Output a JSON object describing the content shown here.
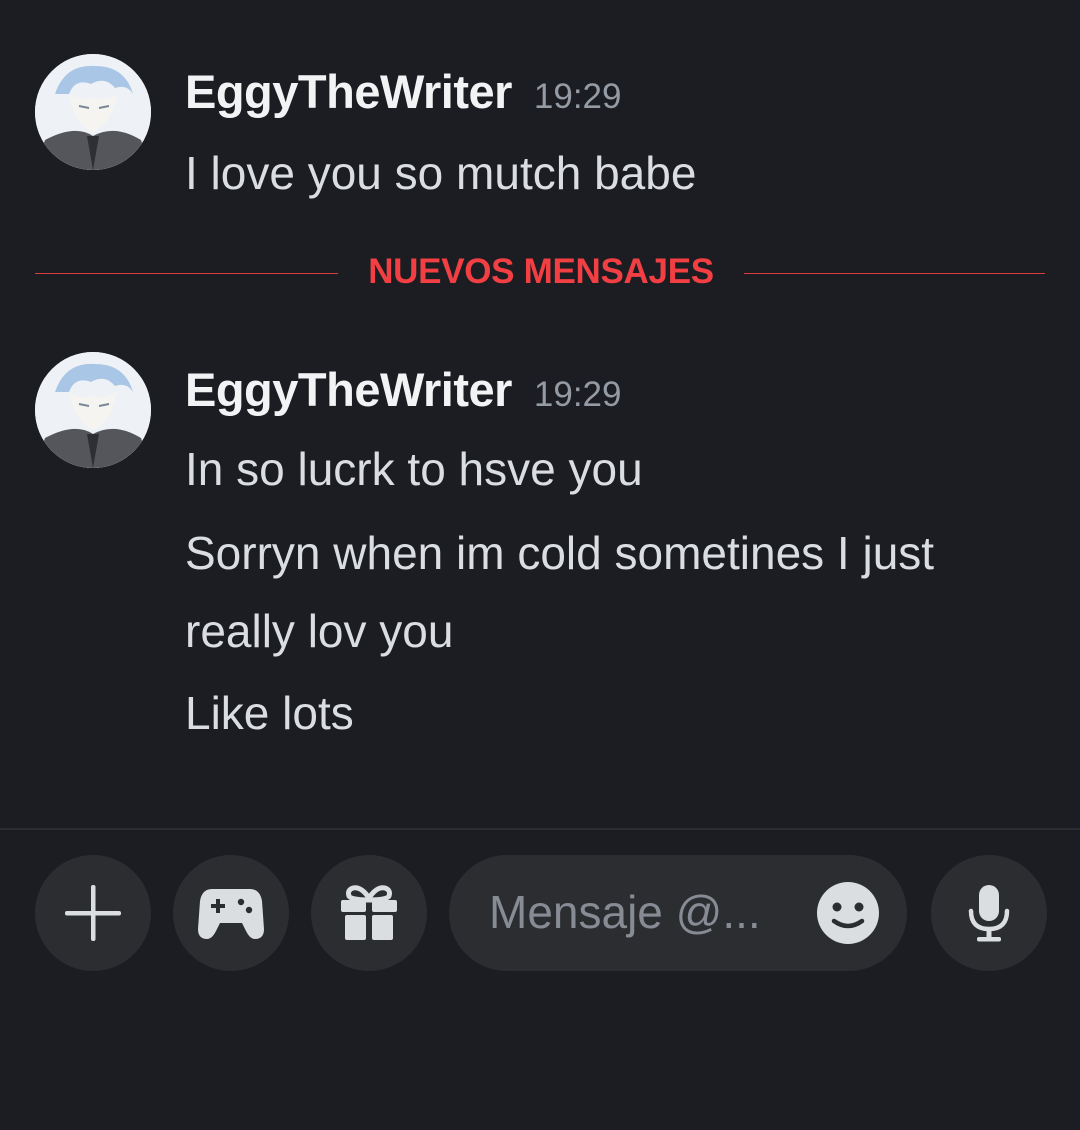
{
  "messages": [
    {
      "username": "EggyTheWriter",
      "timestamp": "19:29",
      "lines": [
        "I love you so mutch babe"
      ]
    },
    {
      "username": "EggyTheWriter",
      "timestamp": "19:29",
      "lines": [
        "In so lucrk to hsve you",
        "Sorryn when im cold sometines I just",
        "really lov you",
        "Like lots"
      ]
    }
  ],
  "divider": {
    "label": "NUEVOS MENSAJES"
  },
  "composer": {
    "placeholder": "Mensaje @...",
    "buttons": [
      "plus-icon",
      "gamepad-icon",
      "gift-icon",
      "emoji-icon",
      "microphone-icon"
    ]
  },
  "colors": {
    "background": "#1c1d22",
    "surface": "#2b2d31",
    "new_messages_red": "#f23f43",
    "username": "#f2f3f5",
    "text": "#dbdee1",
    "muted": "#949ba4"
  }
}
